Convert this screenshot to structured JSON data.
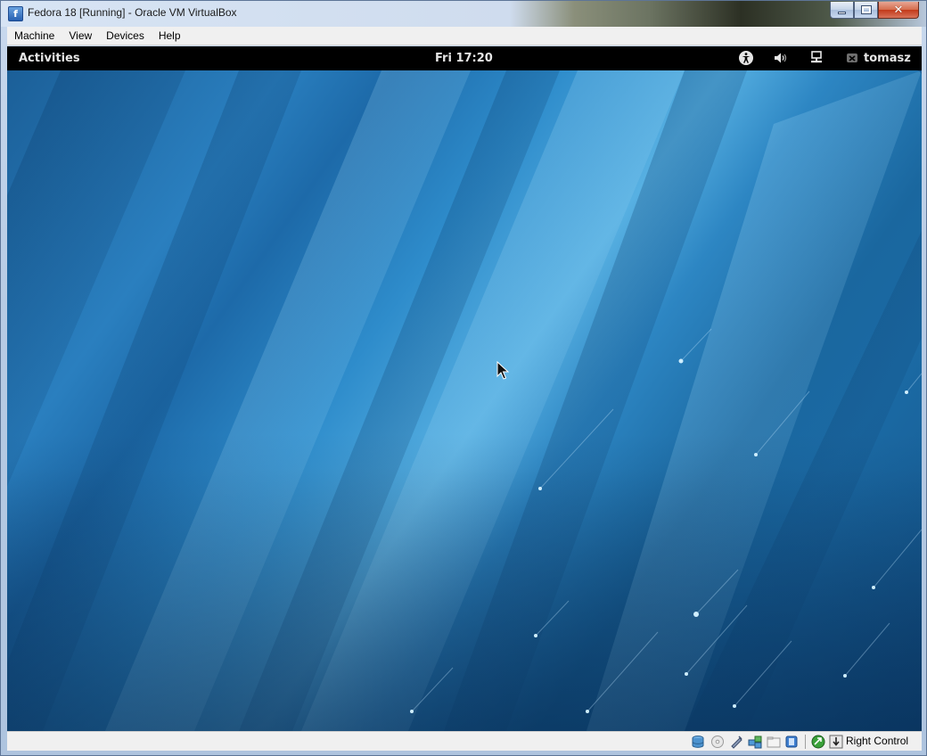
{
  "window": {
    "title": "Fedora 18 [Running] - Oracle VM VirtualBox",
    "app_icon_letter": "f"
  },
  "menubar": {
    "items": [
      {
        "label": "Machine"
      },
      {
        "label": "View"
      },
      {
        "label": "Devices"
      },
      {
        "label": "Help"
      }
    ]
  },
  "gnome_panel": {
    "activities_label": "Activities",
    "clock": "Fri 17:20",
    "user_name": "tomasz",
    "icons": [
      "accessibility-icon",
      "volume-icon",
      "network-wired-icon",
      "user-status-offline-icon"
    ]
  },
  "statusbar": {
    "icons": [
      "hard-disk-icon",
      "optical-drive-icon",
      "usb-icon",
      "network-adapter-icon",
      "shared-folders-icon",
      "video-capture-icon",
      "mouse-integration-icon",
      "host-key-arrow-icon"
    ],
    "host_key_label": "Right Control"
  },
  "colors": {
    "desktop_blue": "#2a7fbf",
    "panel_black": "#000000"
  }
}
